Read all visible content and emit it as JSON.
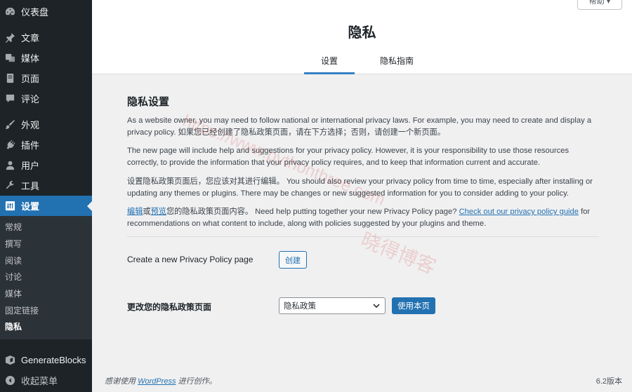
{
  "sidebar": {
    "items": [
      {
        "label": "仪表盘",
        "icon": "dashboard-icon"
      },
      {
        "label": "文章",
        "icon": "pushpin-icon"
      },
      {
        "label": "媒体",
        "icon": "media-icon"
      },
      {
        "label": "页面",
        "icon": "page-icon"
      },
      {
        "label": "评论",
        "icon": "comment-icon"
      },
      {
        "label": "外观",
        "icon": "brush-icon"
      },
      {
        "label": "插件",
        "icon": "plugin-icon"
      },
      {
        "label": "用户",
        "icon": "user-icon"
      },
      {
        "label": "工具",
        "icon": "wrench-icon"
      },
      {
        "label": "设置",
        "icon": "settings-icon"
      }
    ],
    "submenu": [
      "常规",
      "撰写",
      "阅读",
      "讨论",
      "媒体",
      "固定链接",
      "隐私"
    ],
    "bottom": [
      {
        "label": "GenerateBlocks",
        "icon": "generateblocks-icon"
      },
      {
        "label": "收起菜单",
        "icon": "collapse-icon"
      }
    ]
  },
  "header": {
    "help_label": "帮助 ▾",
    "title": "隐私",
    "tabs": [
      "设置",
      "隐私指南"
    ]
  },
  "main": {
    "section_title": "隐私设置",
    "p1": "As a website owner, you may need to follow national or international privacy laws. For example, you may need to create and display a privacy policy. 如果您已经创建了隐私政策页面，请在下方选择；否则，请创建一个新页面。",
    "p2": "The new page will include help and suggestions for your privacy policy. However, it is your responsibility to use those resources correctly, to provide the information that your privacy policy requires, and to keep that information current and accurate.",
    "p3": "设置隐私政策页面后，您应该对其进行编辑。 You should also review your privacy policy from time to time, especially after installing or updating any themes or plugins. There may be changes or new suggested information for you to consider adding to your policy.",
    "p4_link_edit": "编辑",
    "p4_or": "或",
    "p4_link_preview": "预览",
    "p4_text1": "您的隐私政策页面内容。 Need help putting together your new Privacy Policy page? ",
    "p4_link_guide": "Check out our privacy policy guide",
    "p4_text2": " for recommendations on what content to include, along with policies suggested by your plugins and theme.",
    "create_label": "Create a new Privacy Policy page",
    "create_button": "创建",
    "change_label": "更改您的隐私政策页面",
    "select_value": "隐私政策",
    "use_button": "使用本页"
  },
  "footer": {
    "thanks_prefix": "感谢使用",
    "wordpress_link": "WordPress",
    "thanks_suffix": "进行创作。",
    "version": "6.2版本"
  },
  "watermark": {
    "url": "https://www.pythonthree.com",
    "name": "晓得博客"
  }
}
